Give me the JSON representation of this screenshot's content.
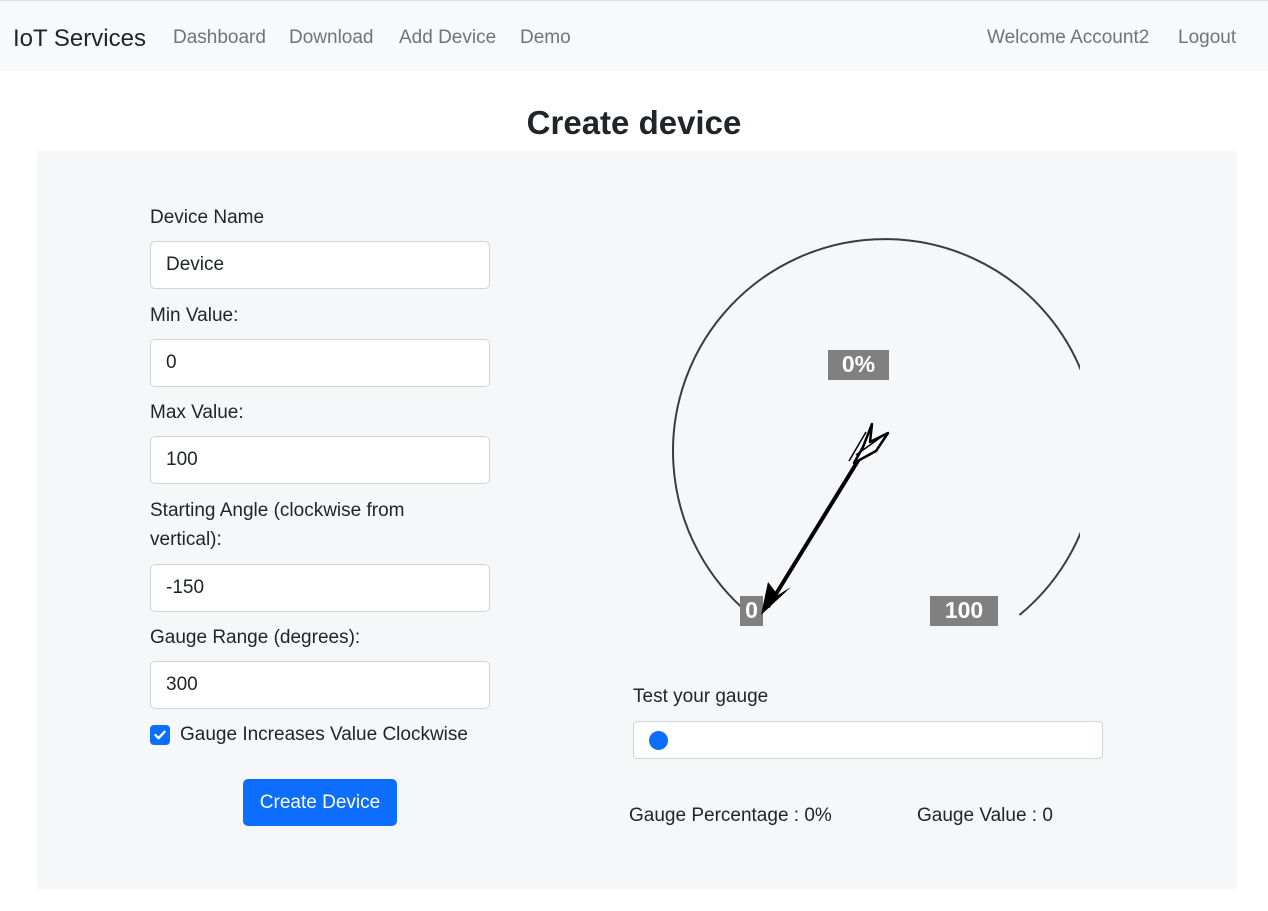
{
  "nav": {
    "brand": "IoT Services",
    "links": [
      "Dashboard",
      "Download",
      "Add Device",
      "Demo"
    ],
    "welcome": "Welcome Account2",
    "logout": "Logout"
  },
  "page": {
    "title": "Create device"
  },
  "form": {
    "device_name": {
      "label": "Device Name",
      "value": "Device"
    },
    "min_value": {
      "label": "Min Value:",
      "value": "0"
    },
    "max_value": {
      "label": "Max Value:",
      "value": "100"
    },
    "starting_angle": {
      "label": "Starting Angle (clockwise from vertical):",
      "value": "-150"
    },
    "gauge_range": {
      "label": "Gauge Range (degrees):",
      "value": "300"
    },
    "clockwise": {
      "label": "Gauge Increases Value Clockwise",
      "checked": true
    },
    "submit_label": "Create Device"
  },
  "gauge": {
    "percent_label": "0%",
    "min_label": "0",
    "max_label": "100",
    "needle_icon": "arrow-needle-icon"
  },
  "test": {
    "label": "Test your gauge",
    "slider_value": 0,
    "percentage_text": "Gauge Percentage : 0%",
    "value_text": "Gauge Value : 0"
  },
  "colors": {
    "accent": "#0d6efd",
    "navbar_bg": "#f8f9fa",
    "panel_bg": "#f6f7f9",
    "gauge_label_bg": "#808080"
  }
}
